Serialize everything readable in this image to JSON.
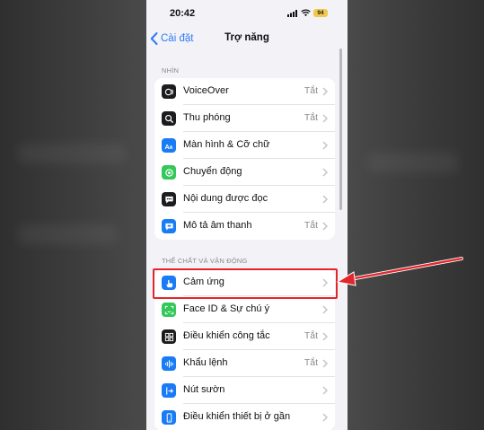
{
  "status_bar": {
    "time": "20:42",
    "battery": "94"
  },
  "nav": {
    "back_label": "Cài đặt",
    "title": "Trợ năng"
  },
  "sections": [
    {
      "header": "NHÌN",
      "rows": [
        {
          "label": "VoiceOver",
          "value": "Tắt",
          "icon": "voiceover-icon",
          "icon_color": "#1c1c1e"
        },
        {
          "label": "Thu phóng",
          "value": "Tắt",
          "icon": "zoom-icon",
          "icon_color": "#1c1c1e"
        },
        {
          "label": "Màn hình & Cỡ chữ",
          "value": "",
          "icon": "text-size-icon",
          "icon_color": "#1a7cf5"
        },
        {
          "label": "Chuyển động",
          "value": "",
          "icon": "motion-icon",
          "icon_color": "#34c759"
        },
        {
          "label": "Nội dung được đọc",
          "value": "",
          "icon": "spoken-content-icon",
          "icon_color": "#1c1c1e"
        },
        {
          "label": "Mô tả âm thanh",
          "value": "Tắt",
          "icon": "audio-description-icon",
          "icon_color": "#1a7cf5"
        }
      ]
    },
    {
      "header": "THỂ CHẤT VÀ VẬN ĐỘNG",
      "rows": [
        {
          "label": "Cảm ứng",
          "value": "",
          "icon": "touch-hand-icon",
          "icon_color": "#1a7cf5"
        },
        {
          "label": "Face ID & Sự chú ý",
          "value": "",
          "icon": "face-id-icon",
          "icon_color": "#34c759"
        },
        {
          "label": "Điều khiển công tắc",
          "value": "Tắt",
          "icon": "switch-control-icon",
          "icon_color": "#1c1c1e"
        },
        {
          "label": "Khẩu lệnh",
          "value": "Tắt",
          "icon": "voice-control-icon",
          "icon_color": "#1a7cf5"
        },
        {
          "label": "Nút sườn",
          "value": "",
          "icon": "side-button-icon",
          "icon_color": "#1a7cf5"
        },
        {
          "label": "Điều khiển thiết bị ở gần",
          "value": "",
          "icon": "nearby-devices-icon",
          "icon_color": "#1a7cf5"
        }
      ]
    }
  ],
  "annotation": {
    "highlight_color": "#e3262b"
  }
}
